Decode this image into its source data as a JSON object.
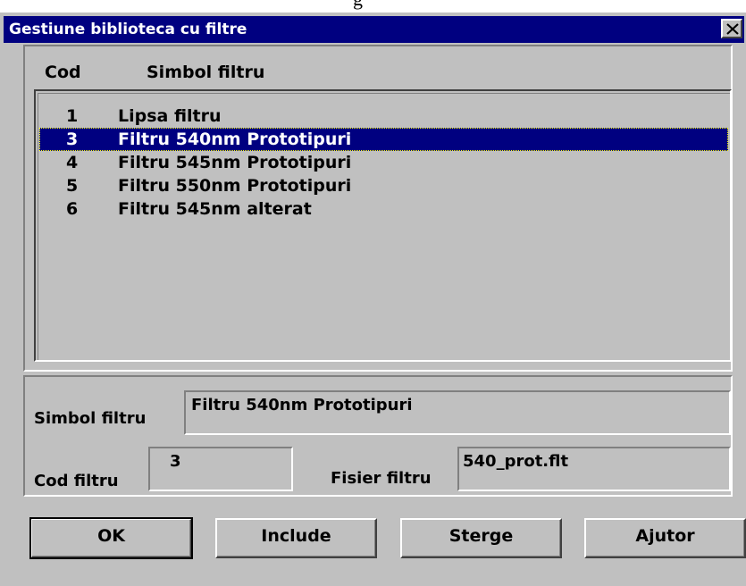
{
  "dialog": {
    "title": "Gestiune biblioteca cu filtre"
  },
  "top_strip_text": "g",
  "list": {
    "headers": {
      "cod": "Cod",
      "simbol": "Simbol filtru"
    },
    "rows": [
      {
        "cod": "1",
        "simbol": "Lipsa filtru",
        "selected": false
      },
      {
        "cod": "3",
        "simbol": "Filtru 540nm Prototipuri",
        "selected": true
      },
      {
        "cod": "4",
        "simbol": "Filtru 545nm Prototipuri",
        "selected": false
      },
      {
        "cod": "5",
        "simbol": "Filtru 550nm Prototipuri",
        "selected": false
      },
      {
        "cod": "6",
        "simbol": "Filtru 545nm alterat",
        "selected": false
      }
    ]
  },
  "details": {
    "simbol_label": "Simbol filtru",
    "simbol_value": "Filtru 540nm Prototipuri",
    "cod_label": "Cod filtru",
    "cod_value": "3",
    "fisier_label": "Fisier filtru",
    "fisier_value": "540_prot.flt"
  },
  "buttons": {
    "ok": "OK",
    "include": "Include",
    "sterge": "Sterge",
    "ajutor": "Ajutor"
  },
  "colors": {
    "face": "#c0c0c0",
    "titlebar": "#000080",
    "selection": "#000080"
  }
}
